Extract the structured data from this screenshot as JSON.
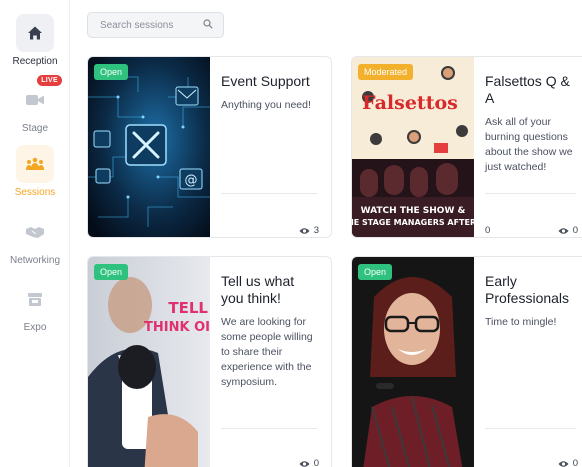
{
  "sidebar": {
    "items": [
      {
        "label": "Reception",
        "icon": "home-icon"
      },
      {
        "label": "Stage",
        "icon": "video-camera-icon",
        "badge": "LIVE"
      },
      {
        "label": "Sessions",
        "icon": "people-group-icon"
      },
      {
        "label": "Networking",
        "icon": "handshake-icon"
      },
      {
        "label": "Expo",
        "icon": "booth-icon"
      }
    ],
    "active": "Sessions",
    "accent": "#f5a623"
  },
  "search": {
    "placeholder": "Search sessions"
  },
  "sessions": [
    {
      "title": "Event Support",
      "description": "Anything you need!",
      "badge": "Open",
      "viewers": "3",
      "count": ""
    },
    {
      "title": "Falsettos Q & A",
      "description": "Ask all of your burning questions about the show we just watched!",
      "badge": "Moderated",
      "viewers": "0",
      "count": "0",
      "poster_title": "Falsettos",
      "poster_banner": "WATCH THE SHOW &",
      "poster_banner2": "THE STAGE MANAGERS AFTER F"
    },
    {
      "title": "Tell us what you think!",
      "description": "We are looking for some people willing to share their experience with the symposium.",
      "badge": "Open",
      "viewers": "0",
      "count": "",
      "image_text1": "TELL",
      "image_text2": "THINK OI"
    },
    {
      "title": "Early Professionals",
      "description": "Time to mingle!",
      "badge": "Open",
      "viewers": "0",
      "count": ""
    }
  ],
  "colors": {
    "open": "#2ec27e",
    "moderated": "#f2b02c",
    "live": "#e53e3e"
  }
}
